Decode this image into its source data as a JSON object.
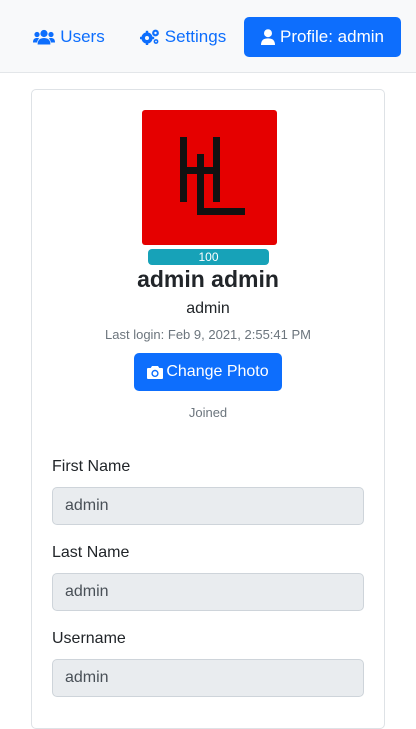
{
  "nav": {
    "users_label": "Users",
    "settings_label": "Settings",
    "profile_label": "Profile: admin",
    "active": "profile",
    "accent": "#0d6efd"
  },
  "profile": {
    "avatar_color": "#e50000",
    "badge": "100",
    "badge_color": "#17a2b8",
    "full_name": "admin admin",
    "username": "admin",
    "last_login": "Last login: Feb 9, 2021, 2:55:41 PM",
    "change_photo_label": "Change Photo",
    "joined_label": "Joined"
  },
  "form": {
    "first_name_label": "First Name",
    "first_name_value": "admin",
    "last_name_label": "Last Name",
    "last_name_value": "admin",
    "username_label": "Username",
    "username_value": "admin"
  },
  "icons": [
    "users-icon",
    "gear-icon",
    "user-icon",
    "camera-icon"
  ]
}
